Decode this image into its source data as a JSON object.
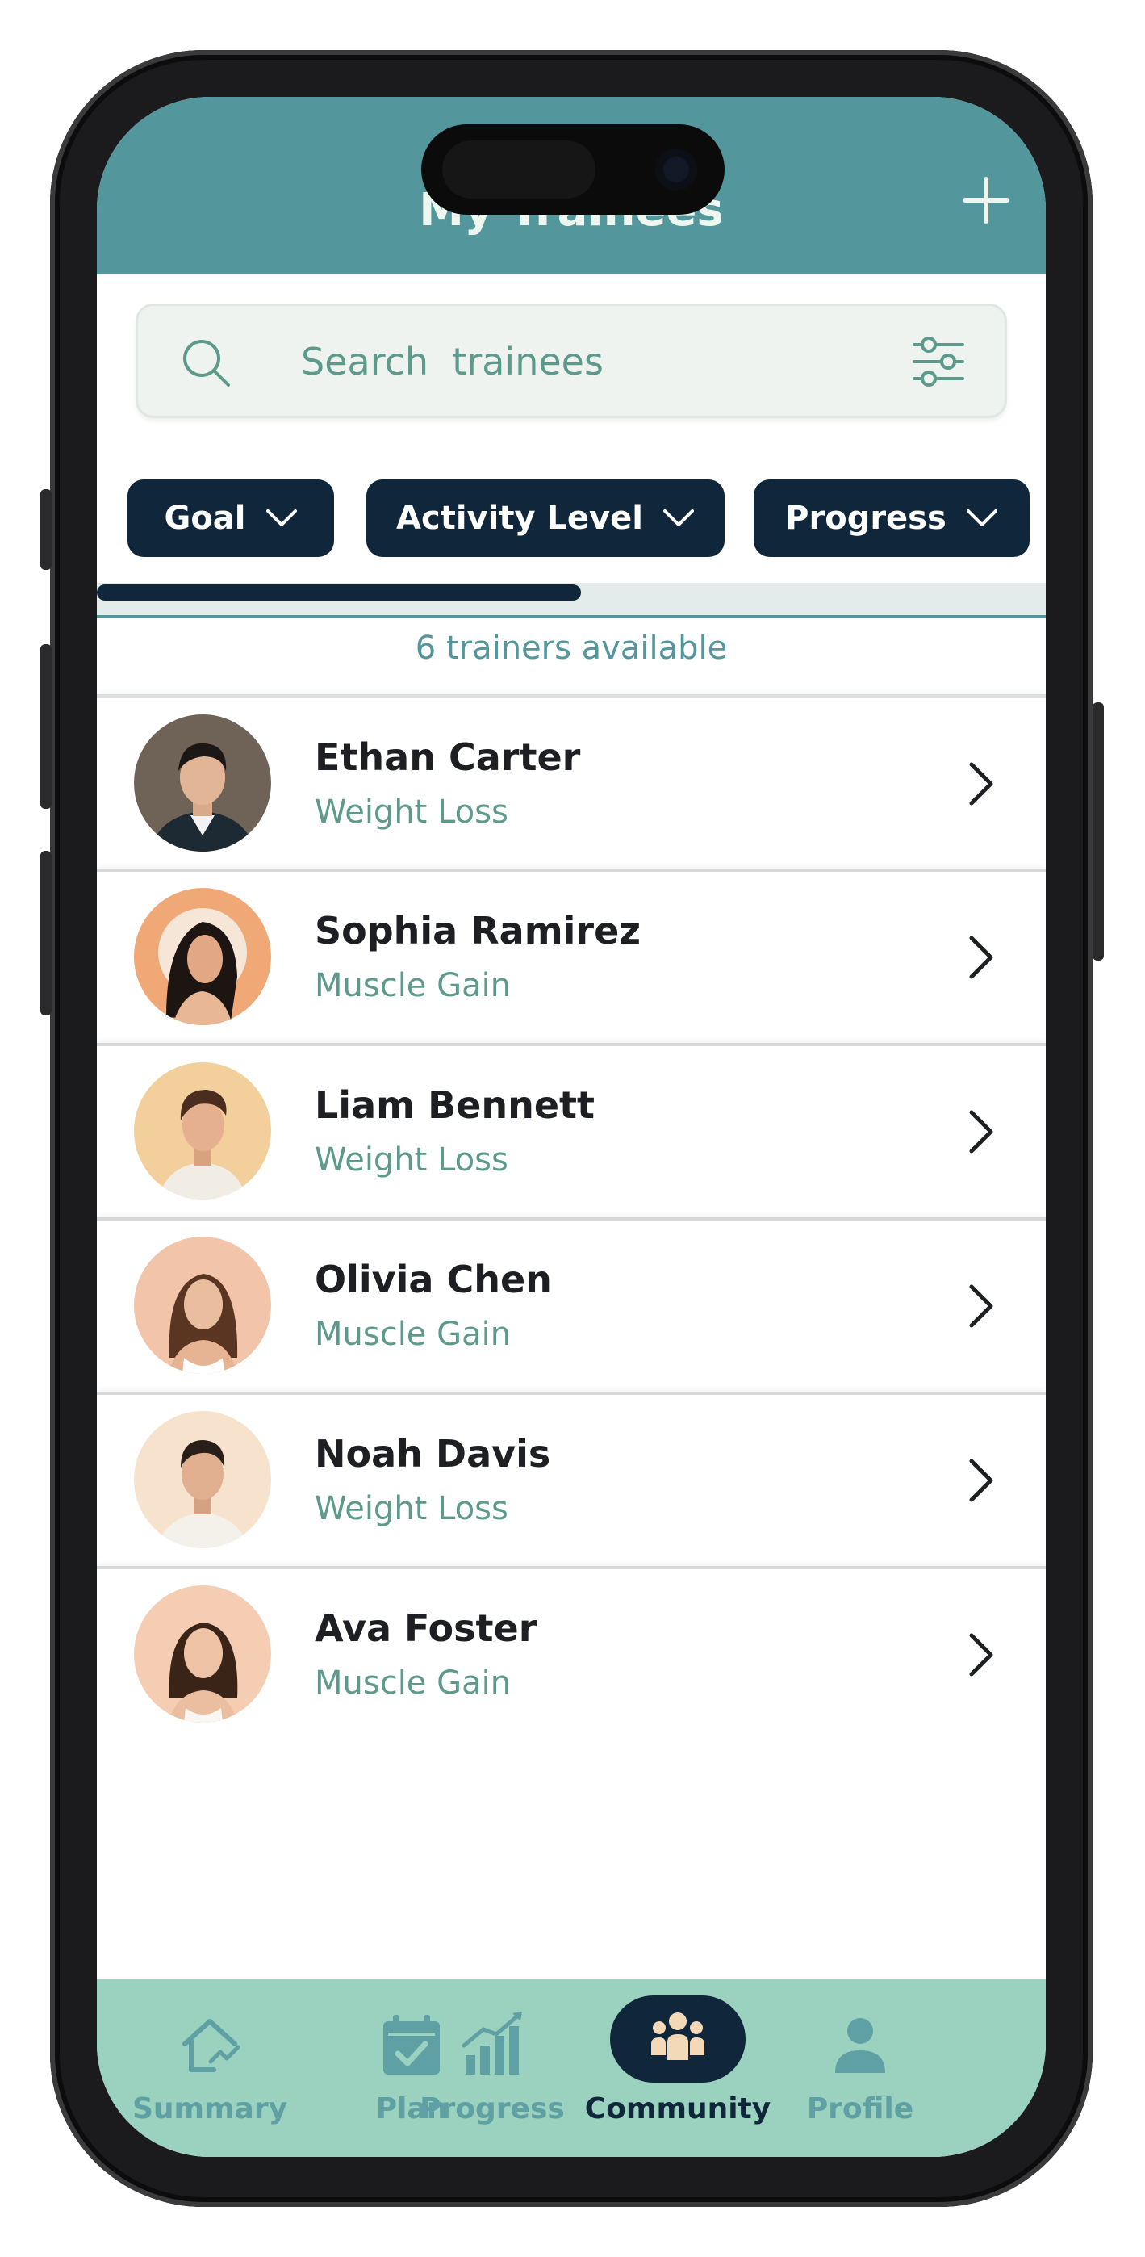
{
  "header": {
    "title": "My Trainees",
    "add_icon": "plus-icon"
  },
  "search": {
    "placeholder": "Search  trainees",
    "value": ""
  },
  "filters": [
    {
      "label": "Goal"
    },
    {
      "label": "Activity Level"
    },
    {
      "label": "Progress"
    }
  ],
  "count_text": "6 trainers available",
  "trainees": [
    {
      "name": "Ethan Carter",
      "goal": "Weight Loss"
    },
    {
      "name": "Sophia Ramirez",
      "goal": "Muscle Gain"
    },
    {
      "name": "Liam Bennett",
      "goal": "Weight Loss"
    },
    {
      "name": "Olivia Chen",
      "goal": "Muscle Gain"
    },
    {
      "name": "Noah Davis",
      "goal": "Weight Loss"
    },
    {
      "name": "Ava Foster",
      "goal": "Muscle Gain"
    }
  ],
  "nav": [
    {
      "label": "Summary",
      "icon": "home-chart-icon"
    },
    {
      "label": "Plan",
      "icon": "calendar-check-icon"
    },
    {
      "label": "Progress",
      "icon": "bar-chart-icon"
    },
    {
      "label": "Community",
      "icon": "group-icon",
      "active": true
    },
    {
      "label": "Profile",
      "icon": "user-icon"
    }
  ],
  "colors": {
    "header_bg": "#53979c",
    "chip_bg": "#10263b",
    "nav_bg": "#9ad1bf",
    "accent_text": "#5d9a8c"
  }
}
